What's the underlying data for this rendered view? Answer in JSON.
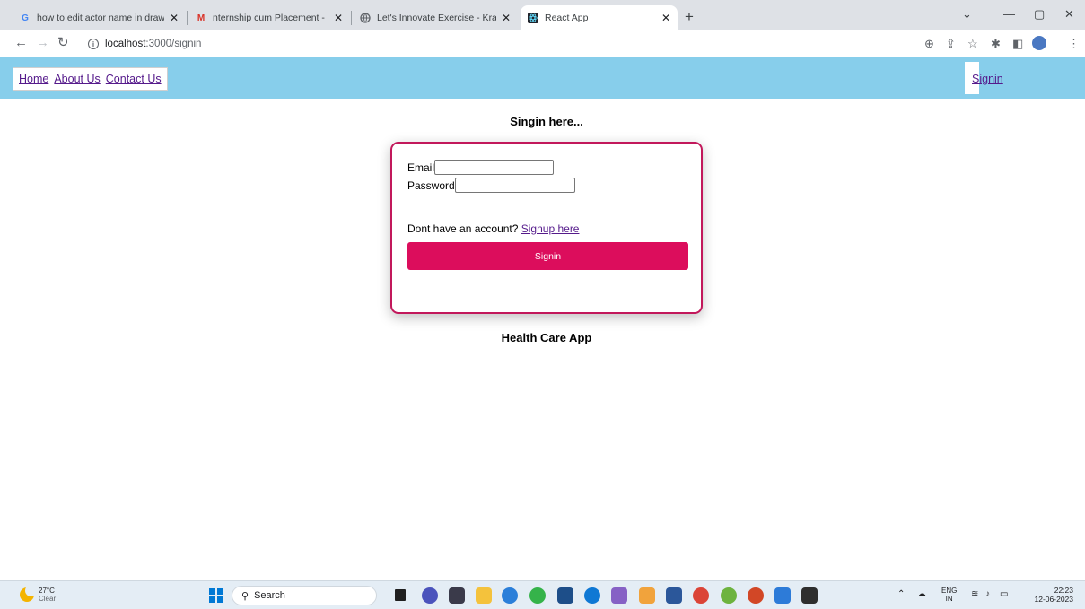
{
  "browser": {
    "tabs": [
      {
        "title": "how to edit actor name in draw.i",
        "favicon": "G",
        "color": "#4285f4",
        "active": false
      },
      {
        "title": "nternship cum Placement - Kratin",
        "favicon": "M",
        "color": "#d93025",
        "active": false
      },
      {
        "title": "Let's Innovate Exercise - Kratin LL",
        "favicon": "globe-icon",
        "color": "#5f6368",
        "active": false
      },
      {
        "title": "React App",
        "favicon": "react-icon",
        "color": "#61dafb",
        "active": true
      }
    ],
    "url_host": "localhost",
    "url_path": ":3000/signin"
  },
  "nav": {
    "links": [
      "Home",
      "About Us",
      "Contact Us"
    ],
    "signin": "Signin"
  },
  "page": {
    "heading": "Singin here...",
    "email_label": "Email",
    "password_label": "Password",
    "account_text": "Dont have an account? ",
    "signup_link": "Signup here",
    "signin_button": "Signin",
    "footer_title": "Health Care App"
  },
  "taskbar": {
    "temperature": "27°C",
    "condition": "Clear",
    "search_placeholder": "Search",
    "lang_top": "ENG",
    "lang_bottom": "IN",
    "time": "22:23",
    "date": "12-06-2023"
  },
  "colors": {
    "navbar": "#87ceeb",
    "accent": "#dc0d5c",
    "card_border": "#c2185b",
    "link": "#551a8b"
  }
}
